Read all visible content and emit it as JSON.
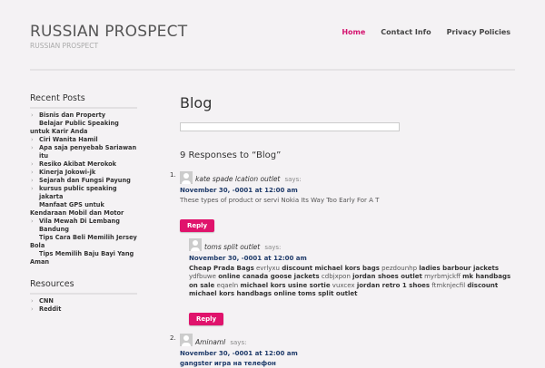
{
  "site": {
    "title": "RUSSIAN PROSPECT",
    "description": "RUSSIAN PROSPECT"
  },
  "nav": {
    "items": [
      "Home",
      "Contact Info",
      "Privacy Policies"
    ]
  },
  "sidebar": {
    "recent_title": "Recent Posts",
    "recent_posts": [
      "Bisnis dan Property",
      "Belajar Public Speaking untuk Karir Anda",
      "Ciri Wanita Hamil",
      "Apa saja penyebab Sariawan itu",
      "Resiko Akibat Merokok",
      "Kinerja Jokowi-jk",
      "Sejarah dan Fungsi Payung",
      "kursus public speaking jakarta",
      "Manfaat GPS untuk Kendaraan Mobil dan Motor",
      "Vila Mewah Di Lembang Bandung",
      "Tips Cara Beli Memilih Jersey Bola",
      "Tips Memilih Baju Bayi Yang Aman"
    ],
    "resources_title": "Resources",
    "resources": [
      "CNN",
      "Reddit"
    ]
  },
  "main": {
    "page_title": "Blog",
    "responses_title": "9 Responses to “Blog”",
    "reply_label": "Reply",
    "says": "says:",
    "comment1": {
      "number": "1.",
      "author": "kate spade lcation outlet",
      "date": "November 30, -0001 at 12:00 am",
      "text": "These types of product or servi Nokia Its Way Too Early For A T"
    },
    "comment1a": {
      "author": "toms split outlet",
      "date": "November 30, -0001 at 12:00 am",
      "segments": [
        [
          "Cheap Prada Bags",
          "b"
        ],
        [
          " evrlyxu ",
          "n"
        ],
        [
          "discount michael kors bags",
          "b"
        ],
        [
          " pezdounhp ",
          "n"
        ],
        [
          "ladies barbour jackets",
          "b"
        ],
        [
          " ydfbuwe ",
          "n"
        ],
        [
          "online canada goose jackets",
          "b"
        ],
        [
          " cdbjxpon ",
          "n"
        ],
        [
          "jordan shoes outlet",
          "b"
        ],
        [
          " myrbmjckff ",
          "n"
        ],
        [
          "mk handbags on sale",
          "b"
        ],
        [
          " eqaeln ",
          "n"
        ],
        [
          "michael kors usine sortie",
          "b"
        ],
        [
          " vuxcex ",
          "n"
        ],
        [
          "jordan retro 1 shoes",
          "b"
        ],
        [
          " ftmknjecfil ",
          "n"
        ],
        [
          "discount michael kors handbags online",
          "b"
        ],
        [
          " ",
          "n"
        ],
        [
          "toms split outlet",
          "b"
        ]
      ]
    },
    "comment2": {
      "number": "2.",
      "author": "Aminaml",
      "date": "November 30, -0001 at 12:00 am",
      "text": "gangster игра на телефон"
    }
  }
}
